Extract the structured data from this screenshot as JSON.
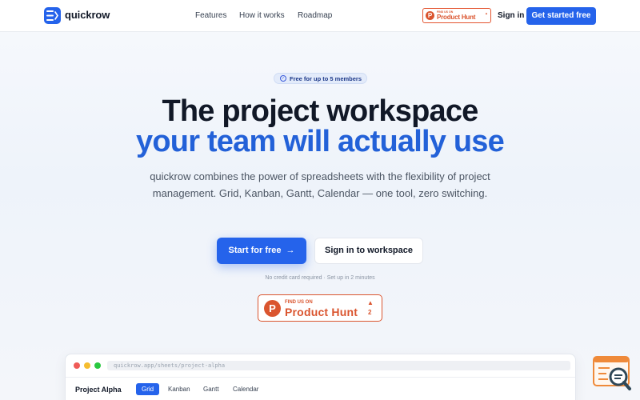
{
  "nav": {
    "brand": "quickrow",
    "links": [
      "Features",
      "How it works",
      "Roadmap"
    ],
    "product_hunt": {
      "find": "FIND US ON",
      "name": "Product Hunt"
    },
    "signin": "Sign in",
    "cta": "Get started free"
  },
  "hero": {
    "badge": "Free for up to 5 members",
    "title_line1": "The project workspace",
    "title_line2": "your team will actually use",
    "subtitle": "quickrow combines the power of spreadsheets with the flexibility of project management. Grid, Kanban, Gantt, Calendar — one tool, zero switching.",
    "primary_button": "Start for free",
    "secondary_button": "Sign in to workspace",
    "note": "No credit card required · Set up in 2 minutes",
    "product_hunt": {
      "letter": "P",
      "find": "FIND US ON",
      "name": "Product Hunt",
      "votes": "2"
    }
  },
  "preview": {
    "url": "quickrow.app/sheets/project-alpha",
    "project": "Project Alpha",
    "tabs": [
      "Grid",
      "Kanban",
      "Gantt",
      "Calendar"
    ],
    "active_tab": "Grid"
  },
  "colors": {
    "accent": "#2563eb",
    "product_hunt": "#da552f",
    "dot_red": "#ef5b57",
    "dot_yellow": "#f5bd2f",
    "dot_green": "#29c840"
  },
  "icons": {
    "logo": "list-lines-icon",
    "badge": "check-circle-icon",
    "primary_button": "arrow-right-icon",
    "widget": "search-chat-icon"
  }
}
